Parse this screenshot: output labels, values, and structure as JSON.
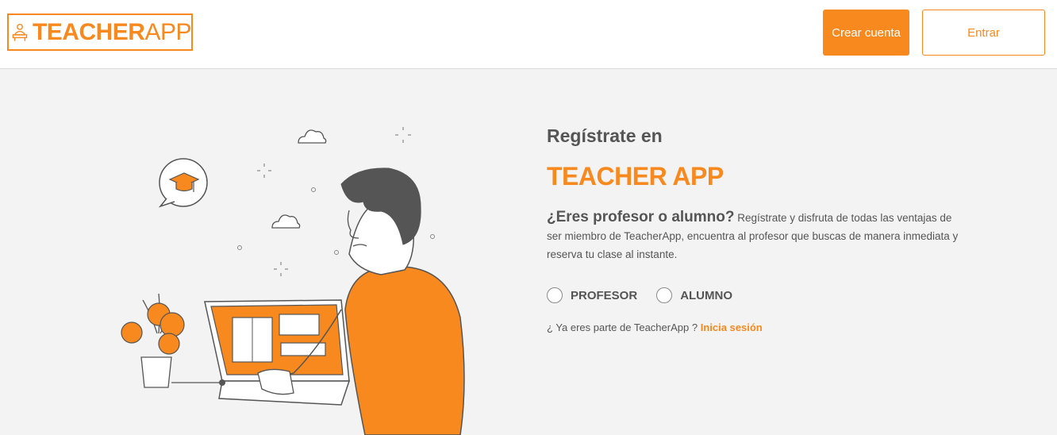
{
  "header": {
    "logo_bold": "TEACHER",
    "logo_light": "APP",
    "create_account_label": "Crear cuenta",
    "login_label": "Entrar"
  },
  "hero": {
    "register_title": "Regístrate en",
    "app_title": "TEACHER APP",
    "question": "¿Eres profesor o alumno?",
    "description": " Regístrate y disfruta de todas las ventajas de ser miembro de TeacherApp, encuentra al profesor que buscas de manera inmediata y reserva tu clase al instante.",
    "options": [
      {
        "label": "PROFESOR",
        "selected": false
      },
      {
        "label": "ALUMNO",
        "selected": false
      }
    ],
    "already_member": "¿ Ya eres parte de TeacherApp ? ",
    "login_link": "Inicia sesión"
  },
  "colors": {
    "accent": "#f7891f",
    "text": "#555555",
    "background": "#f3f3f3"
  }
}
